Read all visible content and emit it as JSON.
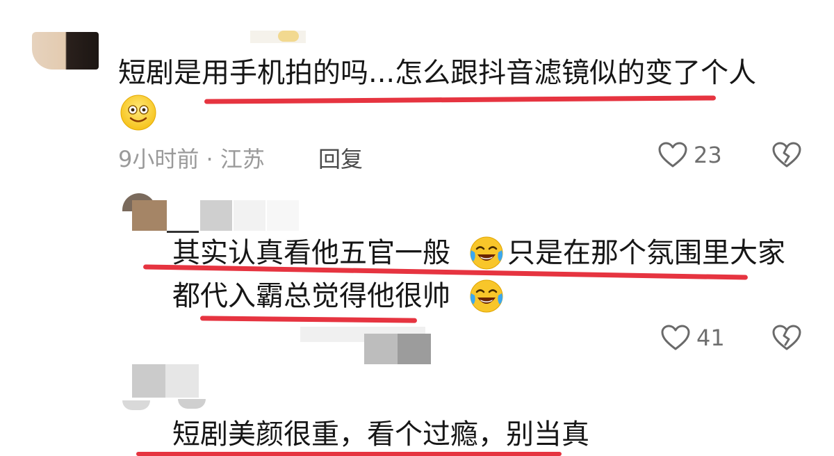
{
  "comments": [
    {
      "text": "短剧是用手机拍的吗...怎么跟抖音滤镜似的变了个人",
      "emoji": "smile-emoji",
      "time_location": "9小时前 · 江苏",
      "reply_label": "回复",
      "likes": "23"
    },
    {
      "text_line1": "其实认真看他五官一般",
      "text_line1b": "只是在那个氛围里大家",
      "text_line2": "都代入霸总觉得他很帅",
      "emoji": "tears-of-joy-emoji",
      "likes": "41"
    },
    {
      "text": "短剧美颜很重，看个过瘾，别当真"
    }
  ],
  "colors": {
    "underline": "#e63440",
    "meta": "#9a9a9a",
    "text": "#161616"
  },
  "icons": [
    "heart-outline-icon",
    "broken-heart-icon"
  ]
}
